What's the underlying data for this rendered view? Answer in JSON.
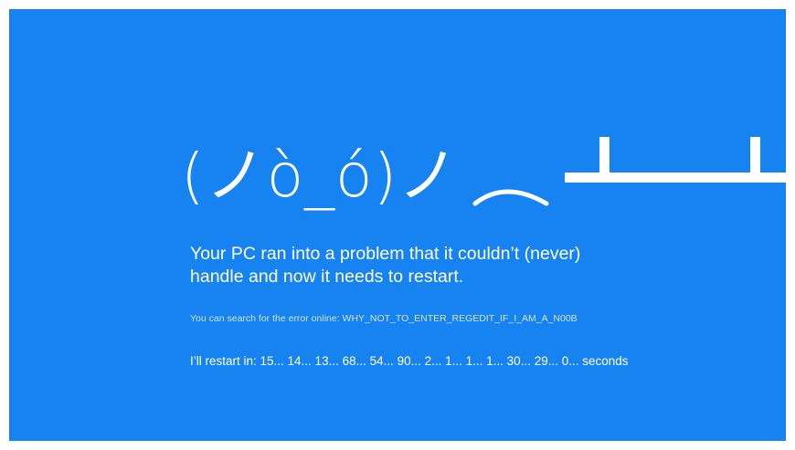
{
  "screen": {
    "background_color": "#1683f1",
    "text_color": "#ffffff"
  },
  "emoticon": {
    "face": "(ノò_ó)ノ",
    "flipped_table_icon": "flipped-table-icon"
  },
  "message": {
    "line1": "Your PC ran into a problem that it couldn’t (never)",
    "line2": "handle and now it needs to restart."
  },
  "error": {
    "text": "You can search for the error online: WHY_NOT_TO_ENTER_REGEDIT_IF_I_AM_A_N00B"
  },
  "restart": {
    "text": "I’ll restart in: 15... 14... 13... 68... 54... 90... 2... 1... 1... 1... 30... 29... 0... seconds"
  }
}
